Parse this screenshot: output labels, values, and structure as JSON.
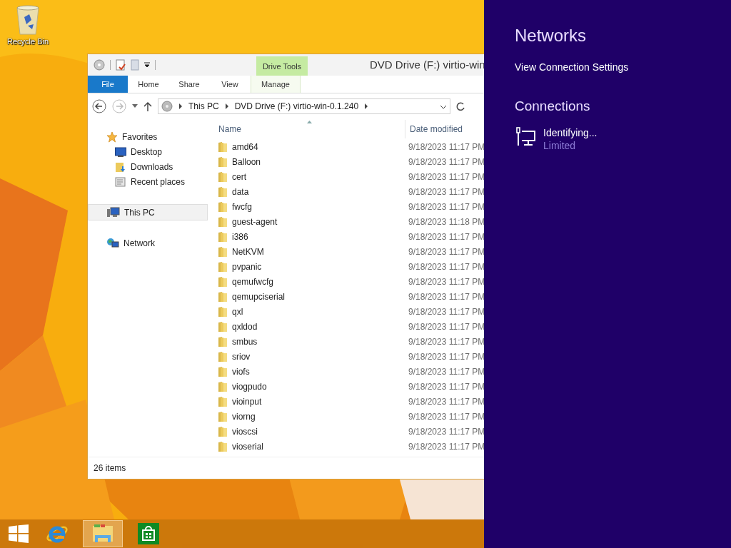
{
  "desktop": {
    "icons": [
      {
        "label": "Recycle Bin"
      }
    ]
  },
  "window": {
    "title": "DVD Drive (F:) virtio-win",
    "context_group": "Drive Tools",
    "tabs": [
      {
        "label": "File",
        "kind": "file",
        "selected": false
      },
      {
        "label": "Home",
        "kind": "tab",
        "selected": false
      },
      {
        "label": "Share",
        "kind": "tab",
        "selected": false
      },
      {
        "label": "View",
        "kind": "tab",
        "selected": false
      },
      {
        "label": "Manage",
        "kind": "context",
        "selected": false
      }
    ],
    "breadcrumbs": [
      "This PC",
      "DVD Drive (F:) virtio-win-0.1.240"
    ],
    "nav": [
      {
        "label": "Favorites",
        "kind": "star",
        "selected": false,
        "children": [
          {
            "label": "Desktop",
            "kind": "desktop",
            "selected": false
          },
          {
            "label": "Downloads",
            "kind": "downloads",
            "selected": false
          },
          {
            "label": "Recent places",
            "kind": "recent",
            "selected": false
          }
        ]
      },
      {
        "label": "This PC",
        "kind": "pc",
        "selected": true
      },
      {
        "label": "Network",
        "kind": "network",
        "selected": false
      }
    ],
    "columns": [
      "Name",
      "Date modified"
    ],
    "rows": [
      {
        "name": "amd64",
        "date": "9/18/2023 11:17 PM"
      },
      {
        "name": "Balloon",
        "date": "9/18/2023 11:17 PM"
      },
      {
        "name": "cert",
        "date": "9/18/2023 11:17 PM"
      },
      {
        "name": "data",
        "date": "9/18/2023 11:17 PM"
      },
      {
        "name": "fwcfg",
        "date": "9/18/2023 11:17 PM"
      },
      {
        "name": "guest-agent",
        "date": "9/18/2023 11:18 PM"
      },
      {
        "name": "i386",
        "date": "9/18/2023 11:17 PM"
      },
      {
        "name": "NetKVM",
        "date": "9/18/2023 11:17 PM"
      },
      {
        "name": "pvpanic",
        "date": "9/18/2023 11:17 PM"
      },
      {
        "name": "qemufwcfg",
        "date": "9/18/2023 11:17 PM"
      },
      {
        "name": "qemupciserial",
        "date": "9/18/2023 11:17 PM"
      },
      {
        "name": "qxl",
        "date": "9/18/2023 11:17 PM"
      },
      {
        "name": "qxldod",
        "date": "9/18/2023 11:17 PM"
      },
      {
        "name": "smbus",
        "date": "9/18/2023 11:17 PM"
      },
      {
        "name": "sriov",
        "date": "9/18/2023 11:17 PM"
      },
      {
        "name": "viofs",
        "date": "9/18/2023 11:17 PM"
      },
      {
        "name": "viogpudo",
        "date": "9/18/2023 11:17 PM"
      },
      {
        "name": "vioinput",
        "date": "9/18/2023 11:17 PM"
      },
      {
        "name": "viorng",
        "date": "9/18/2023 11:17 PM"
      },
      {
        "name": "vioscsi",
        "date": "9/18/2023 11:17 PM"
      },
      {
        "name": "vioserial",
        "date": "9/18/2023 11:17 PM"
      }
    ],
    "status_bar": "26 items"
  },
  "charm": {
    "title": "Networks",
    "link": "View Connection Settings",
    "section": "Connections",
    "connections": [
      {
        "name": "Identifying...",
        "status": "Limited"
      }
    ]
  },
  "taskbar": {
    "items": [
      {
        "kind": "start",
        "selected": false
      },
      {
        "kind": "browser",
        "selected": false
      },
      {
        "kind": "explorer",
        "selected": true
      },
      {
        "kind": "store",
        "selected": false
      }
    ]
  }
}
